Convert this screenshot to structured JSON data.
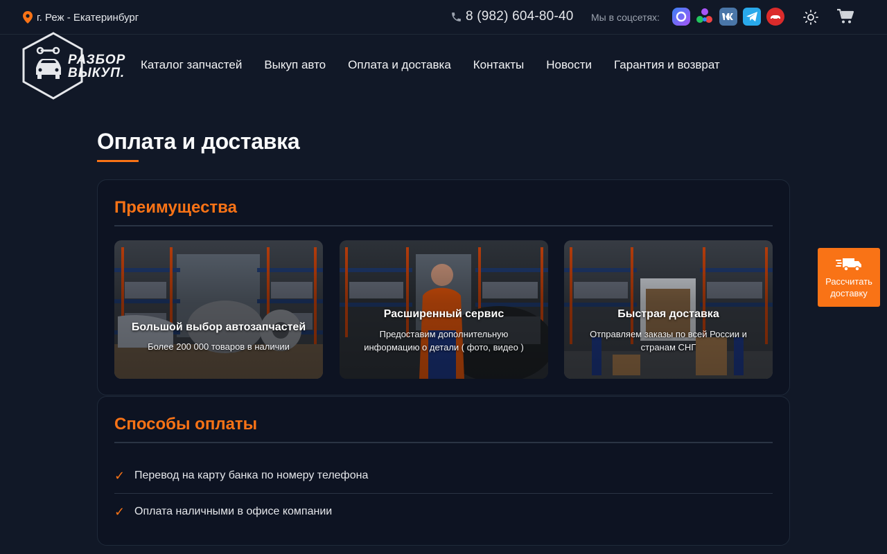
{
  "topbar": {
    "city": "г. Реж - Екатеринбург",
    "phone": "8 (982) 604-80-40",
    "social_label": "Мы в соцсетях:",
    "social_icons": [
      "max-icon",
      "sferum-icon",
      "vk-icon",
      "telegram-icon",
      "drom-icon"
    ]
  },
  "logo": {
    "line1": "РАЗБОР",
    "line2": "ВЫКУП."
  },
  "nav": {
    "items": [
      "Каталог запчастей",
      "Выкуп авто",
      "Оплата и доставка",
      "Контакты",
      "Новости",
      "Гарантия и возврат"
    ]
  },
  "page": {
    "title": "Оплата и доставка"
  },
  "advantages": {
    "title": "Преимущества",
    "tiles": [
      {
        "title": "Большой выбор автозапчастей",
        "subtitle": "Более 200 000 товаров в наличии"
      },
      {
        "title": "Расширенный сервис",
        "subtitle": "Предоставим дополнительную информацию о детали ( фото, видео )"
      },
      {
        "title": "Быстрая доставка",
        "subtitle": "Отправляем заказы по всей России и странам СНГ"
      }
    ]
  },
  "payment": {
    "title": "Способы оплаты",
    "items": [
      "Перевод на карту банка по номеру телефона",
      "Оплата наличными в офисе компании"
    ]
  },
  "calc_button": {
    "label": "Рассчитать доставку"
  },
  "colors": {
    "accent": "#f97316",
    "background": "#111827",
    "card": "#0d1322"
  }
}
